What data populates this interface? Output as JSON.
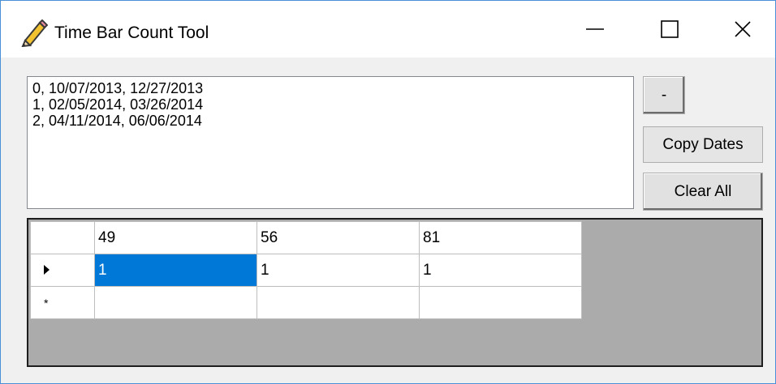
{
  "window": {
    "title": "Time Bar Count Tool",
    "icons": {
      "app": "pencil-icon",
      "minimize": "minimize-icon",
      "maximize": "maximize-icon",
      "close": "close-icon"
    }
  },
  "dates": {
    "lines": [
      "0, 10/07/2013, 12/27/2013",
      "1, 02/05/2014, 03/26/2014",
      "2, 04/11/2014, 06/06/2014"
    ]
  },
  "buttons": {
    "minus_label": "-",
    "copy_label": "Copy Dates",
    "clear_label": "Clear All"
  },
  "grid": {
    "columns": [
      "49",
      "56",
      "81"
    ],
    "rows": [
      {
        "indicator": "current-row-arrow-icon",
        "cells": [
          "1",
          "1",
          "1"
        ]
      },
      {
        "indicator": "new-row-asterisk-icon",
        "cells": [
          "",
          "",
          ""
        ]
      }
    ],
    "new_row_marker": "*",
    "selected_cell": {
      "row": 0,
      "col": 0
    },
    "colors": {
      "selection": "#0078d7",
      "background": "#ababab"
    }
  }
}
